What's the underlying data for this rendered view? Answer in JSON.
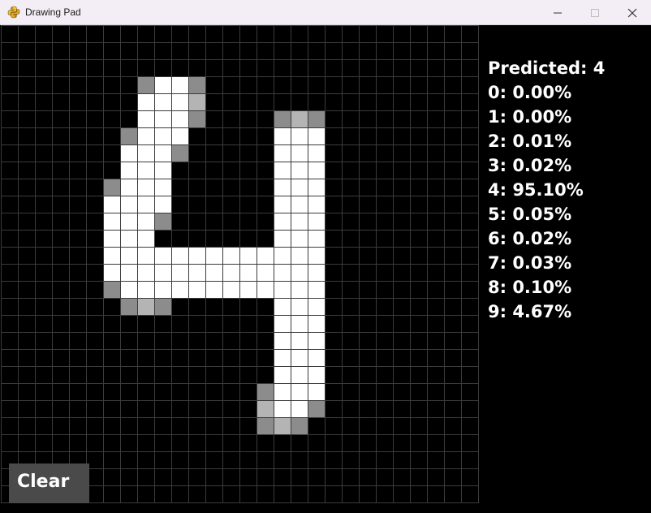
{
  "window": {
    "title": "Drawing Pad",
    "app_icon": "python-icon"
  },
  "controls": {
    "minimize": "minimize-icon",
    "maximize": "maximize-icon",
    "close": "close-icon"
  },
  "prediction": {
    "label": "Predicted: 4",
    "probabilities": [
      "0: 0.00%",
      "1: 0.00%",
      "2: 0.01%",
      "3: 0.02%",
      "4: 95.10%",
      "5: 0.05%",
      "6: 0.02%",
      "7: 0.03%",
      "8: 0.10%",
      "9: 4.67%"
    ]
  },
  "clear_button": {
    "label": "Clear"
  },
  "drawing": {
    "grid_size": 28,
    "colors": {
      "background": "#000000",
      "grid": "#3b3b3b",
      "ink_full": "#ffffff",
      "ink_mid": "#8c8c8c",
      "ink_light": "#b4b4b4",
      "button": "#4a4a4a"
    },
    "pixels": [
      [
        3,
        8,
        "m"
      ],
      [
        3,
        9,
        "w"
      ],
      [
        3,
        10,
        "w"
      ],
      [
        3,
        11,
        "m"
      ],
      [
        4,
        8,
        "w"
      ],
      [
        4,
        9,
        "w"
      ],
      [
        4,
        10,
        "w"
      ],
      [
        4,
        11,
        "l"
      ],
      [
        5,
        8,
        "w"
      ],
      [
        5,
        9,
        "w"
      ],
      [
        5,
        10,
        "w"
      ],
      [
        5,
        11,
        "m"
      ],
      [
        5,
        16,
        "m"
      ],
      [
        5,
        17,
        "l"
      ],
      [
        5,
        18,
        "m"
      ],
      [
        6,
        7,
        "m"
      ],
      [
        6,
        8,
        "w"
      ],
      [
        6,
        9,
        "w"
      ],
      [
        6,
        10,
        "w"
      ],
      [
        6,
        16,
        "w"
      ],
      [
        6,
        17,
        "w"
      ],
      [
        6,
        18,
        "w"
      ],
      [
        7,
        7,
        "w"
      ],
      [
        7,
        8,
        "w"
      ],
      [
        7,
        9,
        "w"
      ],
      [
        7,
        10,
        "m"
      ],
      [
        7,
        16,
        "w"
      ],
      [
        7,
        17,
        "w"
      ],
      [
        7,
        18,
        "w"
      ],
      [
        8,
        7,
        "w"
      ],
      [
        8,
        8,
        "w"
      ],
      [
        8,
        9,
        "w"
      ],
      [
        8,
        16,
        "w"
      ],
      [
        8,
        17,
        "w"
      ],
      [
        8,
        18,
        "w"
      ],
      [
        9,
        6,
        "m"
      ],
      [
        9,
        7,
        "w"
      ],
      [
        9,
        8,
        "w"
      ],
      [
        9,
        9,
        "w"
      ],
      [
        9,
        16,
        "w"
      ],
      [
        9,
        17,
        "w"
      ],
      [
        9,
        18,
        "w"
      ],
      [
        10,
        6,
        "w"
      ],
      [
        10,
        7,
        "w"
      ],
      [
        10,
        8,
        "w"
      ],
      [
        10,
        9,
        "w"
      ],
      [
        10,
        16,
        "w"
      ],
      [
        10,
        17,
        "w"
      ],
      [
        10,
        18,
        "w"
      ],
      [
        11,
        6,
        "w"
      ],
      [
        11,
        7,
        "w"
      ],
      [
        11,
        8,
        "w"
      ],
      [
        11,
        9,
        "m"
      ],
      [
        11,
        16,
        "w"
      ],
      [
        11,
        17,
        "w"
      ],
      [
        11,
        18,
        "w"
      ],
      [
        12,
        6,
        "w"
      ],
      [
        12,
        7,
        "w"
      ],
      [
        12,
        8,
        "w"
      ],
      [
        12,
        16,
        "w"
      ],
      [
        12,
        17,
        "w"
      ],
      [
        12,
        18,
        "w"
      ],
      [
        13,
        6,
        "w"
      ],
      [
        13,
        7,
        "w"
      ],
      [
        13,
        8,
        "w"
      ],
      [
        13,
        9,
        "w"
      ],
      [
        13,
        10,
        "w"
      ],
      [
        13,
        11,
        "w"
      ],
      [
        13,
        12,
        "w"
      ],
      [
        13,
        13,
        "w"
      ],
      [
        13,
        14,
        "w"
      ],
      [
        13,
        15,
        "w"
      ],
      [
        13,
        16,
        "w"
      ],
      [
        13,
        17,
        "w"
      ],
      [
        13,
        18,
        "w"
      ],
      [
        14,
        6,
        "w"
      ],
      [
        14,
        7,
        "w"
      ],
      [
        14,
        8,
        "w"
      ],
      [
        14,
        9,
        "w"
      ],
      [
        14,
        10,
        "w"
      ],
      [
        14,
        11,
        "w"
      ],
      [
        14,
        12,
        "w"
      ],
      [
        14,
        13,
        "w"
      ],
      [
        14,
        14,
        "w"
      ],
      [
        14,
        15,
        "w"
      ],
      [
        14,
        16,
        "w"
      ],
      [
        14,
        17,
        "w"
      ],
      [
        14,
        18,
        "w"
      ],
      [
        15,
        6,
        "m"
      ],
      [
        15,
        7,
        "w"
      ],
      [
        15,
        8,
        "w"
      ],
      [
        15,
        9,
        "w"
      ],
      [
        15,
        10,
        "w"
      ],
      [
        15,
        11,
        "w"
      ],
      [
        15,
        12,
        "w"
      ],
      [
        15,
        13,
        "w"
      ],
      [
        15,
        14,
        "w"
      ],
      [
        15,
        15,
        "w"
      ],
      [
        15,
        16,
        "w"
      ],
      [
        15,
        17,
        "w"
      ],
      [
        15,
        18,
        "w"
      ],
      [
        16,
        7,
        "m"
      ],
      [
        16,
        8,
        "l"
      ],
      [
        16,
        9,
        "m"
      ],
      [
        16,
        16,
        "w"
      ],
      [
        16,
        17,
        "w"
      ],
      [
        16,
        18,
        "w"
      ],
      [
        17,
        16,
        "w"
      ],
      [
        17,
        17,
        "w"
      ],
      [
        17,
        18,
        "w"
      ],
      [
        18,
        16,
        "w"
      ],
      [
        18,
        17,
        "w"
      ],
      [
        18,
        18,
        "w"
      ],
      [
        19,
        16,
        "w"
      ],
      [
        19,
        17,
        "w"
      ],
      [
        19,
        18,
        "w"
      ],
      [
        20,
        16,
        "w"
      ],
      [
        20,
        17,
        "w"
      ],
      [
        20,
        18,
        "w"
      ],
      [
        21,
        15,
        "m"
      ],
      [
        21,
        16,
        "w"
      ],
      [
        21,
        17,
        "w"
      ],
      [
        21,
        18,
        "w"
      ],
      [
        22,
        15,
        "l"
      ],
      [
        22,
        16,
        "w"
      ],
      [
        22,
        17,
        "w"
      ],
      [
        22,
        18,
        "m"
      ],
      [
        23,
        15,
        "m"
      ],
      [
        23,
        16,
        "l"
      ],
      [
        23,
        17,
        "m"
      ]
    ]
  }
}
